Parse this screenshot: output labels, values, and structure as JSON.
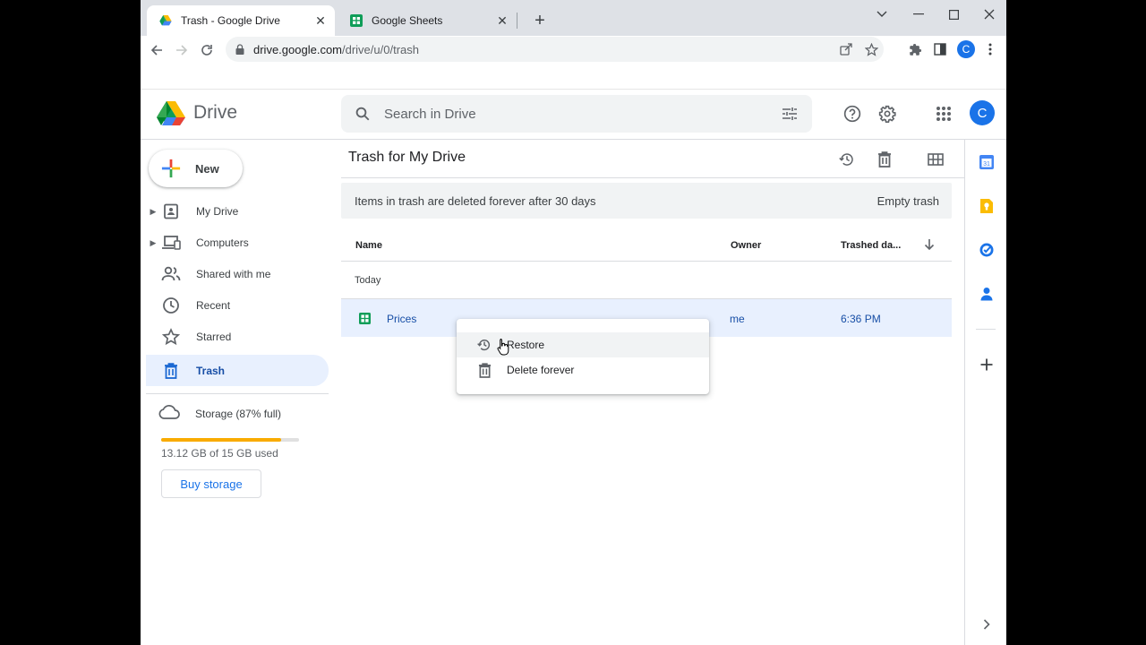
{
  "browser": {
    "tabs": [
      {
        "title": "Trash - Google Drive",
        "active": true
      },
      {
        "title": "Google Sheets",
        "active": false
      }
    ],
    "url": {
      "host": "drive.google.com",
      "path": "/drive/u/0/trash"
    },
    "profile_letter": "C"
  },
  "header": {
    "app_name": "Drive",
    "search_placeholder": "Search in Drive",
    "avatar_letter": "C"
  },
  "sidebar": {
    "new_label": "New",
    "items": [
      {
        "label": "My Drive",
        "icon": "my-drive-icon"
      },
      {
        "label": "Computers",
        "icon": "computers-icon"
      },
      {
        "label": "Shared with me",
        "icon": "shared-icon"
      },
      {
        "label": "Recent",
        "icon": "clock-icon"
      },
      {
        "label": "Starred",
        "icon": "star-icon"
      },
      {
        "label": "Trash",
        "icon": "trash-icon",
        "active": true
      }
    ],
    "storage": {
      "label": "Storage (87% full)",
      "used_fraction": 0.87,
      "used_text": "13.12 GB of 15 GB used",
      "buy_label": "Buy storage"
    }
  },
  "main": {
    "title": "Trash for My Drive",
    "banner_message": "Items in trash are deleted forever after 30 days",
    "empty_trash_label": "Empty trash",
    "columns": {
      "name": "Name",
      "owner": "Owner",
      "trashed": "Trashed da..."
    },
    "group_label": "Today",
    "files": [
      {
        "name": "Prices",
        "owner": "me",
        "trashed": "6:36 PM",
        "type": "sheets"
      }
    ]
  },
  "context_menu": {
    "items": [
      {
        "label": "Restore",
        "icon": "restore-icon"
      },
      {
        "label": "Delete forever",
        "icon": "trash-icon"
      }
    ]
  },
  "colors": {
    "accent": "#1a73e8",
    "selected_row": "#e8f0fe",
    "storage_fill": "#f9ab00",
    "sheets_green": "#0f9d58"
  }
}
